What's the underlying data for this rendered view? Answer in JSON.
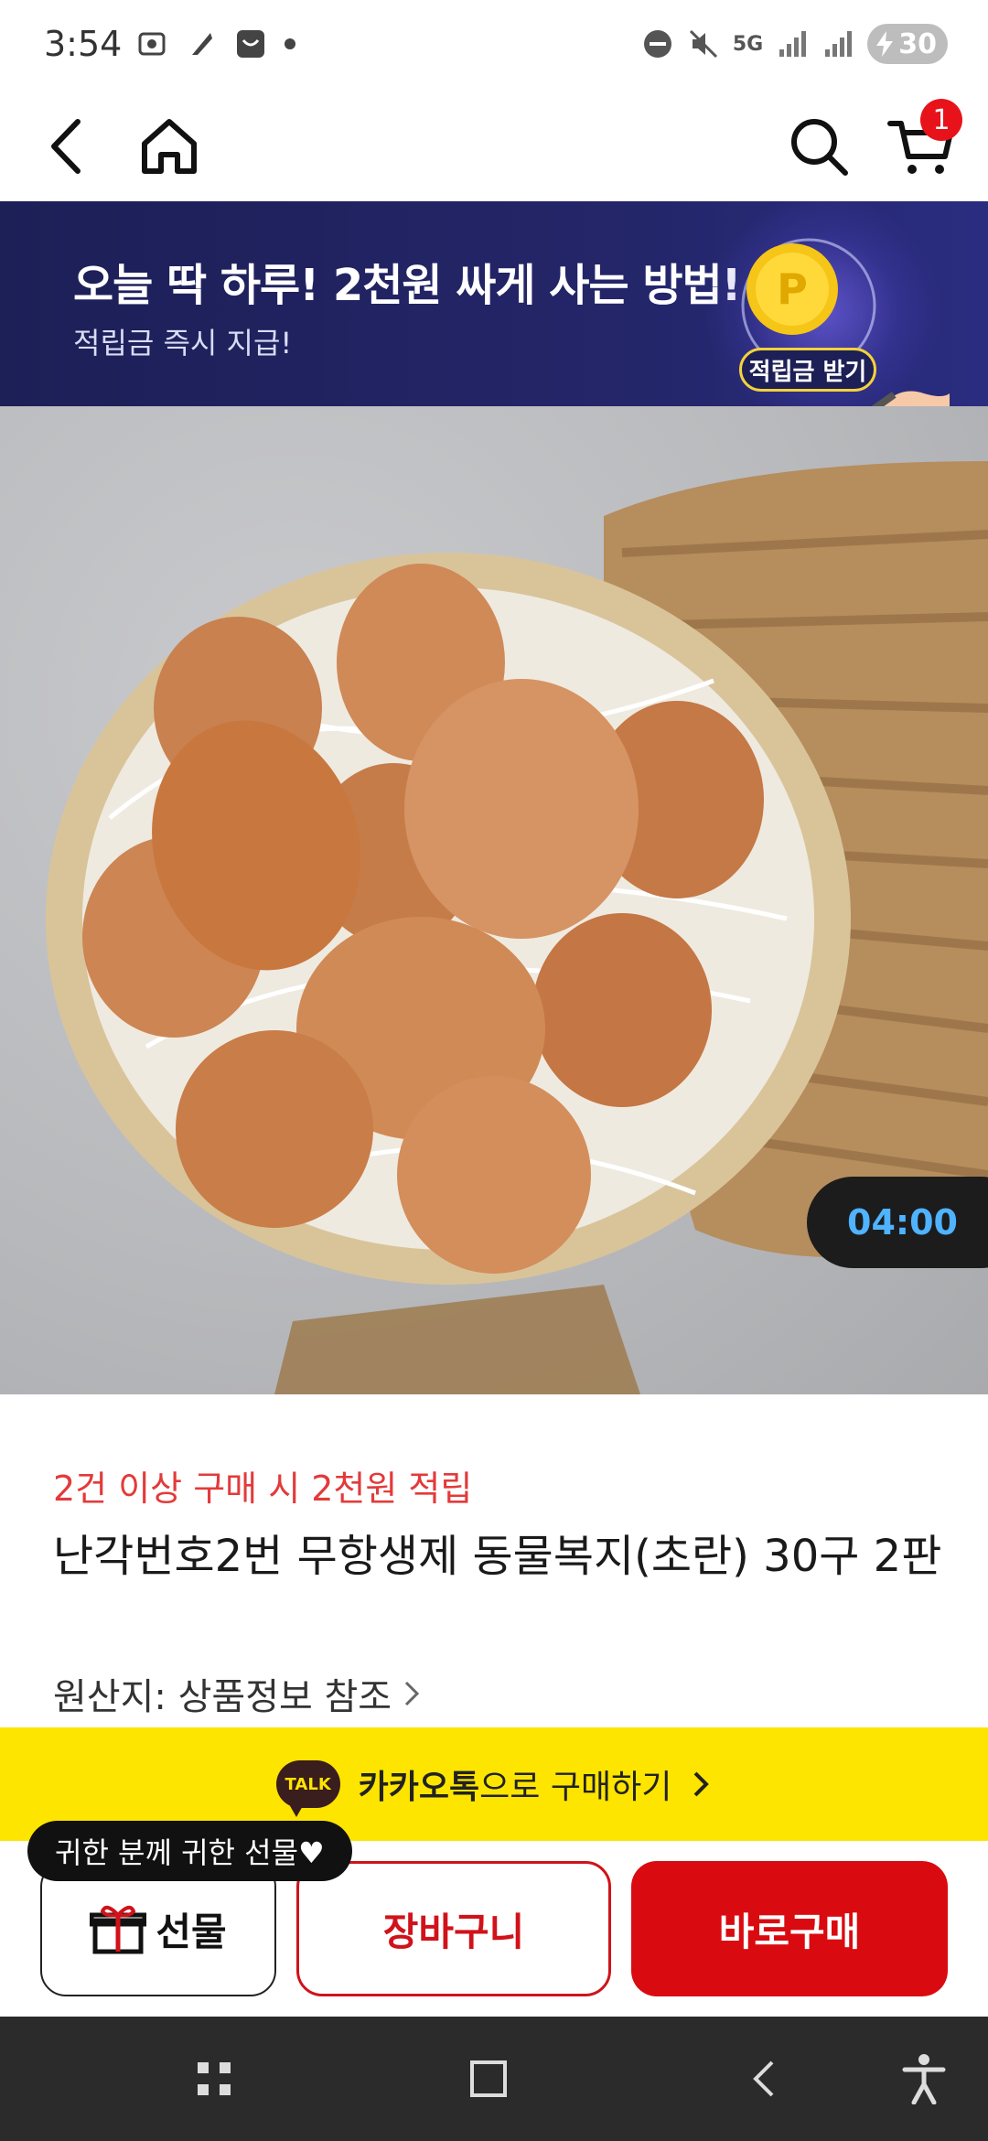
{
  "status_bar": {
    "time": "3:54",
    "network": "5G",
    "battery": "30"
  },
  "cart": {
    "badge_count": "1"
  },
  "banner": {
    "title": "오늘 딱 하루! 2천원 싸게 사는 방법!",
    "subtitle": "적립금 즉시 지급!",
    "coin_letter": "P",
    "button_label": "적립금 받기"
  },
  "product": {
    "timer": "04:00",
    "promo": "2건 이상 구매 시 2천원 적립",
    "title": "난각번호2번 무항생제 동물복지(초란) 30구 2판",
    "origin": "원산지: 상품정보 참조"
  },
  "kakao": {
    "badge": "TALK",
    "bold": "카카오톡",
    "rest": "으로 구매하기"
  },
  "actions": {
    "tooltip": "귀한 분께 귀한 선물♥",
    "gift_label": "선물",
    "cart_label": "장바구니",
    "buy_label": "바로구매"
  },
  "colors": {
    "accent_red": "#d90b10",
    "kakao_yellow": "#fee500",
    "banner_navy": "#1d1f57",
    "timer_blue": "#4fb3ff"
  },
  "icons": [
    "back-icon",
    "home-icon",
    "search-icon",
    "cart-icon",
    "gift-icon",
    "chevron-right-icon",
    "recent-apps-icon",
    "home-square-icon",
    "nav-back-icon",
    "accessibility-icon"
  ]
}
